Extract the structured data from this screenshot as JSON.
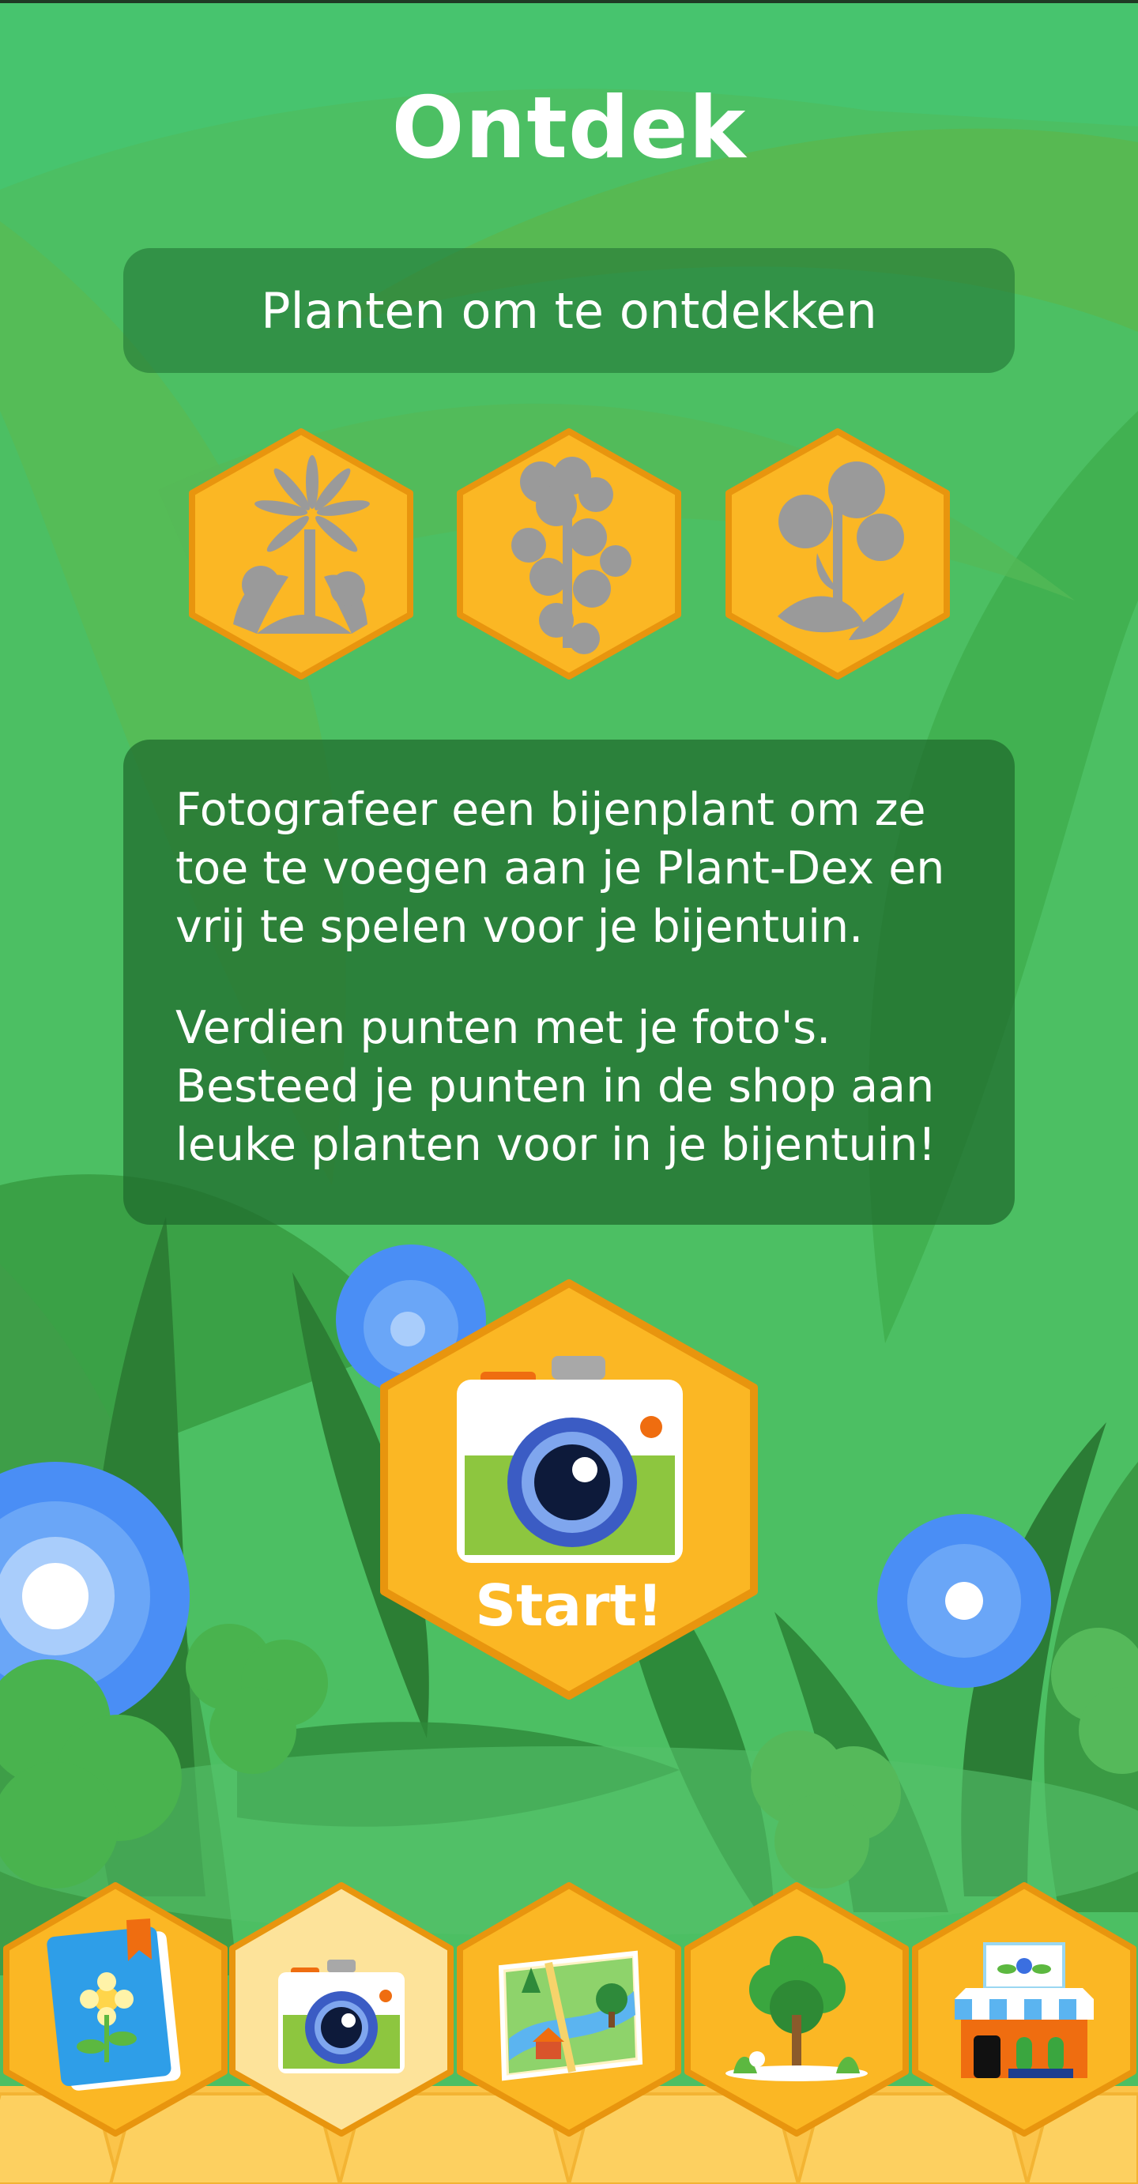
{
  "header": {
    "title": "Ontdek"
  },
  "discover": {
    "heading": "Planten om te ontdekken",
    "plants": [
      {
        "icon": "dandelion-silhouette-icon"
      },
      {
        "icon": "clover-flower-silhouette-icon"
      },
      {
        "icon": "thistle-silhouette-icon"
      }
    ]
  },
  "info": {
    "paragraph1": "Fotografeer een bijenplant om ze toe te voegen aan je Plant-Dex en vrij te spelen voor je bijentuin.",
    "paragraph2": "Verdien punten met je foto's. Besteed je punten in de shop aan leuke planten voor in je bijentuin!"
  },
  "start_button": {
    "label": "Start!",
    "icon": "camera-icon"
  },
  "bottom_nav": {
    "items": [
      {
        "icon": "plant-dex-book-icon",
        "selected": false
      },
      {
        "icon": "camera-icon",
        "selected": true
      },
      {
        "icon": "map-icon",
        "selected": false
      },
      {
        "icon": "tree-garden-icon",
        "selected": false
      },
      {
        "icon": "shop-icon",
        "selected": false
      }
    ]
  },
  "colors": {
    "background_green": "#4cbf63",
    "panel_green": "#2f7d3c",
    "hex_orange": "#fbb724",
    "hex_border": "#e8950e",
    "nav_selected": "#fde39a",
    "silhouette_gray": "#9a9a9a",
    "flower_blue": "#4a8ef5"
  }
}
